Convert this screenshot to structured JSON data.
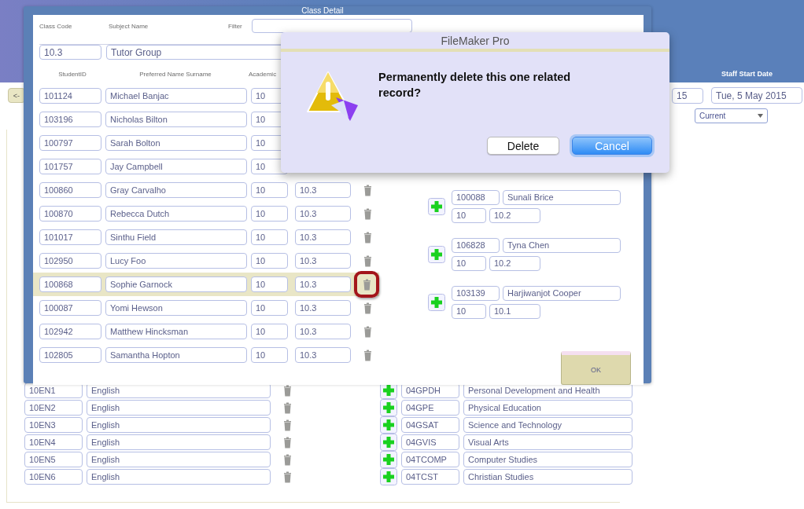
{
  "background": {
    "back_button": "<-",
    "staff_start_label": "Staff Start Date",
    "date_field": "15",
    "start_date": "Tue, 5 May 2015",
    "status_select": "Current",
    "classes": [
      {
        "code": "10EN1",
        "subject": "English"
      },
      {
        "code": "10EN2",
        "subject": "English"
      },
      {
        "code": "10EN3",
        "subject": "English"
      },
      {
        "code": "10EN4",
        "subject": "English"
      },
      {
        "code": "10EN5",
        "subject": "English"
      },
      {
        "code": "10EN6",
        "subject": "English"
      }
    ],
    "subjects": [
      {
        "code": "04GPDH",
        "name": "Personal Development and Health"
      },
      {
        "code": "04GPE",
        "name": "Physical Education"
      },
      {
        "code": "04GSAT",
        "name": "Science and Technology"
      },
      {
        "code": "04GVIS",
        "name": "Visual Arts"
      },
      {
        "code": "04TCOMP",
        "name": "Computer Studies"
      },
      {
        "code": "04TCST",
        "name": "Christian Studies"
      }
    ]
  },
  "class_detail": {
    "title": "Class Detail",
    "class_code_label": "Class Code",
    "subject_name_label": "Subject Name",
    "filter_label": "Filter",
    "class_code": "10.3",
    "subject_name": "Tutor Group",
    "columns": [
      "StudentID",
      "Preferred Name Surname",
      "Academic"
    ],
    "students": [
      {
        "id": "101124",
        "name": "Michael Banjac",
        "year": "10",
        "selected": false
      },
      {
        "id": "103196",
        "name": "Nicholas Bilton",
        "year": "10",
        "selected": false
      },
      {
        "id": "100797",
        "name": "Sarah Bolton",
        "year": "10",
        "selected": false
      },
      {
        "id": "101757",
        "name": "Jay Campbell",
        "year": "10",
        "selected": false
      },
      {
        "id": "100860",
        "name": "Gray Carvalho",
        "year": "10",
        "class": "10.3",
        "selected": false
      },
      {
        "id": "100870",
        "name": "Rebecca Dutch",
        "year": "10",
        "class": "10.3",
        "selected": false
      },
      {
        "id": "101017",
        "name": "Sinthu Field",
        "year": "10",
        "class": "10.3",
        "selected": false
      },
      {
        "id": "102950",
        "name": "Lucy Foo",
        "year": "10",
        "class": "10.3",
        "selected": false
      },
      {
        "id": "100868",
        "name": "Sophie Garnock",
        "year": "10",
        "class": "10.3",
        "selected": true
      },
      {
        "id": "100087",
        "name": "Yomi Hewson",
        "year": "10",
        "class": "10.3",
        "selected": false
      },
      {
        "id": "102942",
        "name": "Matthew Hincksman",
        "year": "10",
        "class": "10.3",
        "selected": false
      },
      {
        "id": "102805",
        "name": "Samantha Hopton",
        "year": "10",
        "class": "10.3",
        "selected": false
      }
    ],
    "available": [
      {
        "id": "100088",
        "name": "Sunali Brice",
        "year": "10",
        "class": "10.2"
      },
      {
        "id": "106828",
        "name": "Tyna Chen",
        "year": "10",
        "class": "10.2"
      },
      {
        "id": "103139",
        "name": "Harjiwanjot Cooper",
        "year": "10",
        "class": "10.1"
      }
    ],
    "ok_button": "OK"
  },
  "dialog": {
    "title": "FileMaker Pro",
    "message": "Permanently delete this one related record?",
    "buttons": [
      {
        "label": "Delete",
        "default": false
      },
      {
        "label": "Cancel",
        "default": true
      }
    ]
  }
}
